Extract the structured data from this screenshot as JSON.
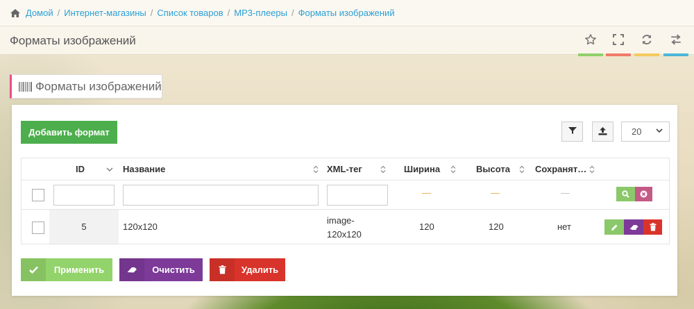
{
  "breadcrumb": {
    "items": [
      "Домой",
      "Интернет-магазины",
      "Список товаров",
      "MP3-плееры",
      "Форматы изображений"
    ],
    "separator": "/"
  },
  "header": {
    "title": "Форматы изображений",
    "buttons": [
      {
        "icon": "star-icon",
        "accent": "#8fd16a"
      },
      {
        "icon": "fullscreen-icon",
        "accent": "#f07a6a"
      },
      {
        "icon": "refresh-icon",
        "accent": "#f4c95d"
      },
      {
        "icon": "swap-icon",
        "accent": "#4cb6d9"
      }
    ]
  },
  "widget": {
    "title": "Форматы изображений",
    "icon": "barcode-icon",
    "accent": "#e8508a"
  },
  "toolbar": {
    "add_label": "Добавить формат",
    "page_size": "20"
  },
  "table": {
    "columns": [
      "ID",
      "Название",
      "XML-тег",
      "Ширина",
      "Высота",
      "Сохранят…"
    ],
    "filter_dash": "—",
    "rows": [
      {
        "id": "5",
        "name": "120x120",
        "xml_tag_line1": "image-",
        "xml_tag_line2": "120x120",
        "width": "120",
        "height": "120",
        "keep": "нет"
      }
    ]
  },
  "actions": {
    "apply_label": "Применить",
    "clear_label": "Очистить",
    "delete_label": "Удалить"
  },
  "colors": {
    "link": "#2a9fd6",
    "success": "#4cae4c",
    "apply": "#93d36b",
    "clear": "#7d3a99",
    "delete": "#d9342b"
  }
}
